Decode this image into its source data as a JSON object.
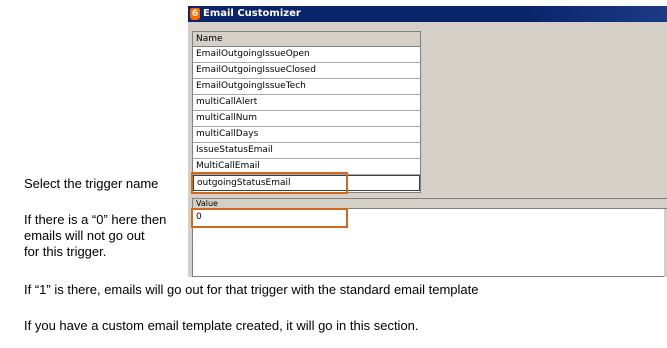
{
  "window": {
    "title": "Email Customizer",
    "icon": "app-flame-icon"
  },
  "name_table": {
    "header": "Name",
    "rows": [
      "EmailOutgoingIssueOpen",
      "EmailOutgoingIssueClosed",
      "EmailOutgoingIssueTech",
      "multiCallAlert",
      "multiCallNum",
      "multiCallDays",
      "IssueStatusEmail",
      "MultiCallEmail",
      "outgoingStatusEmail"
    ],
    "selected": "outgoingStatusEmail"
  },
  "value_panel": {
    "header": "Value",
    "value": "0"
  },
  "instructions": {
    "select_trigger": "Select the trigger name",
    "zero_line1": "If there is a “0” here then",
    "zero_line2": "emails will not go out",
    "zero_line3": "for this trigger.",
    "one_note": "If “1” is there, emails will go out for that trigger with the standard email template",
    "custom_note": "If you have a custom email template created, it will go in this section."
  },
  "colors": {
    "titlebar": "#0a246a",
    "annotation": "#d0691e",
    "window_background": "#d4d0c8"
  }
}
